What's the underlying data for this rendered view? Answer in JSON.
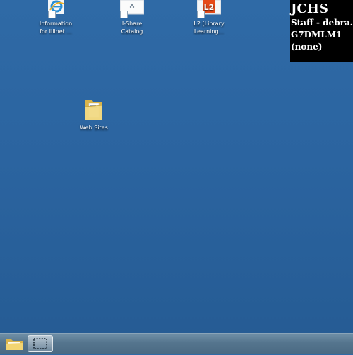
{
  "desktop": {
    "icons": [
      {
        "label_line1": "Information",
        "label_line2": "for Illinet ..."
      },
      {
        "label_line1": "I-Share",
        "label_line2": "Catalog"
      },
      {
        "label_line1": "L2 [Library",
        "label_line2": "Learning..."
      },
      {
        "label_line1": "Web Sites",
        "label_line2": ""
      }
    ]
  },
  "info_panel": {
    "school": "JCHS",
    "user": "Staff - debra.",
    "computer": "G7DMLM1",
    "extra": "(none)"
  },
  "taskbar": {
    "buttons": [
      {
        "icon": "folder-icon"
      },
      {
        "icon": "snipping-tool-icon"
      }
    ]
  },
  "colors": {
    "desktop_background": "#2b64a0",
    "ie_blue": "#2a8fd6",
    "l2_red": "#e64a19",
    "folder_yellow": "#e8c964"
  }
}
